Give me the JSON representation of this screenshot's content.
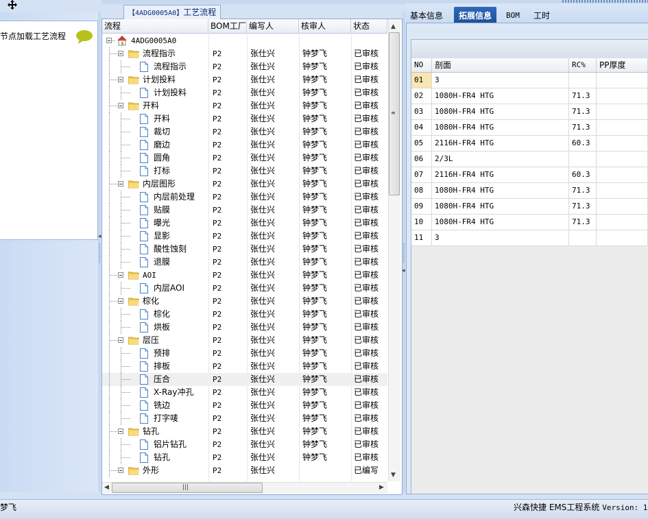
{
  "left": {
    "card_text": "节点加载工艺流程"
  },
  "middle": {
    "title_code": "【4ADG0005A0】",
    "title_text": "工艺流程",
    "columns": [
      "流程",
      "BOM工厂",
      "编写人",
      "核审人",
      "状态"
    ],
    "rows": [
      {
        "level": 0,
        "type": "root",
        "name": "4ADG0005A0",
        "bom": "",
        "writer": "",
        "reviewer": "",
        "status": ""
      },
      {
        "level": 1,
        "type": "folder",
        "name": "流程指示",
        "bom": "P2",
        "writer": "张仕兴",
        "reviewer": "钟梦飞",
        "status": "已审核"
      },
      {
        "level": 2,
        "type": "doc",
        "name": "流程指示",
        "bom": "P2",
        "writer": "张仕兴",
        "reviewer": "钟梦飞",
        "status": "已审核"
      },
      {
        "level": 1,
        "type": "folder",
        "name": "计划投料",
        "bom": "P2",
        "writer": "张仕兴",
        "reviewer": "钟梦飞",
        "status": "已审核"
      },
      {
        "level": 2,
        "type": "doc",
        "name": "计划投料",
        "bom": "P2",
        "writer": "张仕兴",
        "reviewer": "钟梦飞",
        "status": "已审核"
      },
      {
        "level": 1,
        "type": "folder",
        "name": "开料",
        "bom": "P2",
        "writer": "张仕兴",
        "reviewer": "钟梦飞",
        "status": "已审核"
      },
      {
        "level": 2,
        "type": "doc",
        "name": "开料",
        "bom": "P2",
        "writer": "张仕兴",
        "reviewer": "钟梦飞",
        "status": "已审核"
      },
      {
        "level": 2,
        "type": "doc",
        "name": "裁切",
        "bom": "P2",
        "writer": "张仕兴",
        "reviewer": "钟梦飞",
        "status": "已审核"
      },
      {
        "level": 2,
        "type": "doc",
        "name": "磨边",
        "bom": "P2",
        "writer": "张仕兴",
        "reviewer": "钟梦飞",
        "status": "已审核"
      },
      {
        "level": 2,
        "type": "doc",
        "name": "圆角",
        "bom": "P2",
        "writer": "张仕兴",
        "reviewer": "钟梦飞",
        "status": "已审核"
      },
      {
        "level": 2,
        "type": "doc",
        "name": "打标",
        "bom": "P2",
        "writer": "张仕兴",
        "reviewer": "钟梦飞",
        "status": "已审核"
      },
      {
        "level": 1,
        "type": "folder",
        "name": "内层图形",
        "bom": "P2",
        "writer": "张仕兴",
        "reviewer": "钟梦飞",
        "status": "已审核"
      },
      {
        "level": 2,
        "type": "doc",
        "name": "内层前处理",
        "bom": "P2",
        "writer": "张仕兴",
        "reviewer": "钟梦飞",
        "status": "已审核"
      },
      {
        "level": 2,
        "type": "doc",
        "name": "贴膜",
        "bom": "P2",
        "writer": "张仕兴",
        "reviewer": "钟梦飞",
        "status": "已审核"
      },
      {
        "level": 2,
        "type": "doc",
        "name": "曝光",
        "bom": "P2",
        "writer": "张仕兴",
        "reviewer": "钟梦飞",
        "status": "已审核"
      },
      {
        "level": 2,
        "type": "doc",
        "name": "显影",
        "bom": "P2",
        "writer": "张仕兴",
        "reviewer": "钟梦飞",
        "status": "已审核"
      },
      {
        "level": 2,
        "type": "doc",
        "name": "酸性蚀刻",
        "bom": "P2",
        "writer": "张仕兴",
        "reviewer": "钟梦飞",
        "status": "已审核"
      },
      {
        "level": 2,
        "type": "doc",
        "name": "退膜",
        "bom": "P2",
        "writer": "张仕兴",
        "reviewer": "钟梦飞",
        "status": "已审核"
      },
      {
        "level": 1,
        "type": "folder",
        "name": "AOI",
        "bom": "P2",
        "writer": "张仕兴",
        "reviewer": "钟梦飞",
        "status": "已审核"
      },
      {
        "level": 2,
        "type": "doc",
        "name": "内层AOI",
        "bom": "P2",
        "writer": "张仕兴",
        "reviewer": "钟梦飞",
        "status": "已审核"
      },
      {
        "level": 1,
        "type": "folder",
        "name": "棕化",
        "bom": "P2",
        "writer": "张仕兴",
        "reviewer": "钟梦飞",
        "status": "已审核"
      },
      {
        "level": 2,
        "type": "doc",
        "name": "棕化",
        "bom": "P2",
        "writer": "张仕兴",
        "reviewer": "钟梦飞",
        "status": "已审核"
      },
      {
        "level": 2,
        "type": "doc",
        "name": "烘板",
        "bom": "P2",
        "writer": "张仕兴",
        "reviewer": "钟梦飞",
        "status": "已审核"
      },
      {
        "level": 1,
        "type": "folder",
        "name": "层压",
        "bom": "P2",
        "writer": "张仕兴",
        "reviewer": "钟梦飞",
        "status": "已审核"
      },
      {
        "level": 2,
        "type": "doc",
        "name": "预排",
        "bom": "P2",
        "writer": "张仕兴",
        "reviewer": "钟梦飞",
        "status": "已审核"
      },
      {
        "level": 2,
        "type": "doc",
        "name": "排板",
        "bom": "P2",
        "writer": "张仕兴",
        "reviewer": "钟梦飞",
        "status": "已审核"
      },
      {
        "level": 2,
        "type": "doc",
        "name": "压合",
        "bom": "P2",
        "writer": "张仕兴",
        "reviewer": "钟梦飞",
        "status": "已审核",
        "selected": true
      },
      {
        "level": 2,
        "type": "doc",
        "name": "X-Ray冲孔",
        "bom": "P2",
        "writer": "张仕兴",
        "reviewer": "钟梦飞",
        "status": "已审核"
      },
      {
        "level": 2,
        "type": "doc",
        "name": "铣边",
        "bom": "P2",
        "writer": "张仕兴",
        "reviewer": "钟梦飞",
        "status": "已审核"
      },
      {
        "level": 2,
        "type": "doc",
        "name": "打字唛",
        "bom": "P2",
        "writer": "张仕兴",
        "reviewer": "钟梦飞",
        "status": "已审核"
      },
      {
        "level": 1,
        "type": "folder",
        "name": "钻孔",
        "bom": "P2",
        "writer": "张仕兴",
        "reviewer": "钟梦飞",
        "status": "已审核"
      },
      {
        "level": 2,
        "type": "doc",
        "name": "铝片钻孔",
        "bom": "P2",
        "writer": "张仕兴",
        "reviewer": "钟梦飞",
        "status": "已审核"
      },
      {
        "level": 2,
        "type": "doc",
        "name": "钻孔",
        "bom": "P2",
        "writer": "张仕兴",
        "reviewer": "钟梦飞",
        "status": "已审核"
      },
      {
        "level": 1,
        "type": "folder",
        "name": "外形",
        "bom": "P2",
        "writer": "张仕兴",
        "reviewer": "",
        "status": "已编写"
      }
    ]
  },
  "right": {
    "tabs": [
      "基本信息",
      "拓展信息",
      "BOM",
      "工时"
    ],
    "active_tab": 1,
    "grid_columns": [
      "NO",
      "剖面",
      "RC%",
      "PP厚度"
    ],
    "grid_rows": [
      {
        "no": "01",
        "section": "3",
        "rc": "",
        "pp": "",
        "selected": true
      },
      {
        "no": "02",
        "section": "1080H-FR4 HTG",
        "rc": "71.3",
        "pp": ""
      },
      {
        "no": "03",
        "section": "1080H-FR4 HTG",
        "rc": "71.3",
        "pp": ""
      },
      {
        "no": "04",
        "section": "1080H-FR4 HTG",
        "rc": "71.3",
        "pp": ""
      },
      {
        "no": "05",
        "section": "2116H-FR4 HTG",
        "rc": "60.3",
        "pp": ""
      },
      {
        "no": "06",
        "section": "2/3L",
        "rc": "",
        "pp": ""
      },
      {
        "no": "07",
        "section": "2116H-FR4 HTG",
        "rc": "60.3",
        "pp": ""
      },
      {
        "no": "08",
        "section": "1080H-FR4 HTG",
        "rc": "71.3",
        "pp": ""
      },
      {
        "no": "09",
        "section": "1080H-FR4 HTG",
        "rc": "71.3",
        "pp": ""
      },
      {
        "no": "10",
        "section": "1080H-FR4 HTG",
        "rc": "71.3",
        "pp": ""
      },
      {
        "no": "11",
        "section": "3",
        "rc": "",
        "pp": ""
      }
    ]
  },
  "status": {
    "left_text": "梦飞",
    "right_cn": "兴森快捷 EMS工程系统",
    "right_version": "Version: 1"
  },
  "colors": {
    "accent": "#1c4e98",
    "selected_no_cell": "#f9e6b3",
    "folder": "#f3c94c",
    "bubble": "#b6c21a",
    "root_icon": "#d23a2a"
  }
}
